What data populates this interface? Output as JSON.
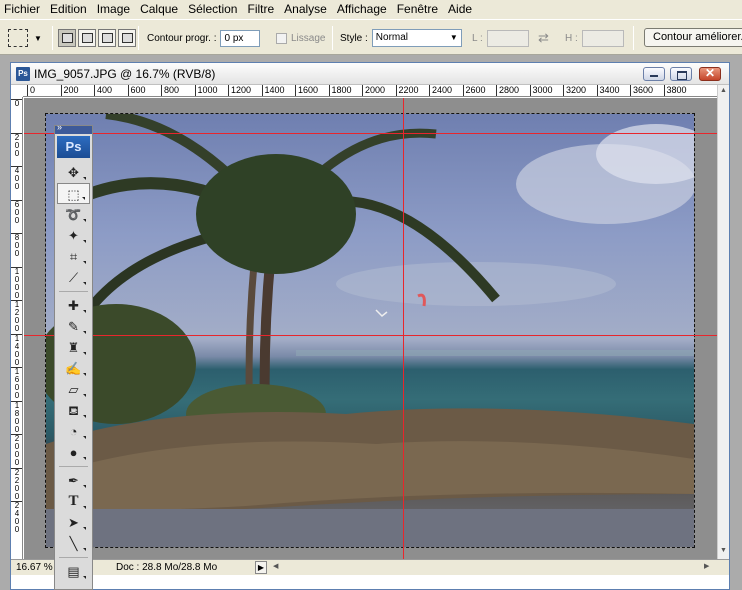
{
  "menu": [
    "Fichier",
    "Edition",
    "Image",
    "Calque",
    "Sélection",
    "Filtre",
    "Analyse",
    "Affichage",
    "Fenêtre",
    "Aide"
  ],
  "options": {
    "contour_label": "Contour progr. :",
    "contour_value": "0 px",
    "lissage_label": "Lissage",
    "style_label": "Style :",
    "style_value": "Normal",
    "width_label": "L :",
    "height_label": "H :",
    "refine_button": "Contour améliorer..."
  },
  "document": {
    "title": "IMG_9057.JPG @ 16.7% (RVB/8)",
    "ps_badge": "Ps",
    "zoom": "16.67 %",
    "doc_info": "Doc : 28.8 Mo/28.8 Mo"
  },
  "ruler": {
    "horizontal": [
      "0",
      "200",
      "400",
      "600",
      "800",
      "1000",
      "1200",
      "1400",
      "1600",
      "1800",
      "2000",
      "2200",
      "2400",
      "2600",
      "2800",
      "3000",
      "3200",
      "3400",
      "3600",
      "3800"
    ],
    "vertical": [
      "0",
      "2 0 0",
      "4 0 0",
      "6 0 0",
      "8 0 0",
      "1 0 0 0",
      "1 2 0 0",
      "1 4 0 0",
      "1 6 0 0",
      "1 8 0 0",
      "2 0 0 0",
      "2 2 0 0",
      "2 4 0 0"
    ]
  },
  "tools_palette": {
    "logo": "Ps",
    "text_tool": "T"
  },
  "colors": {
    "guide": "#e8262c",
    "title_bar_border": "#5d7fb0",
    "ps_blue": "#2b5797"
  }
}
